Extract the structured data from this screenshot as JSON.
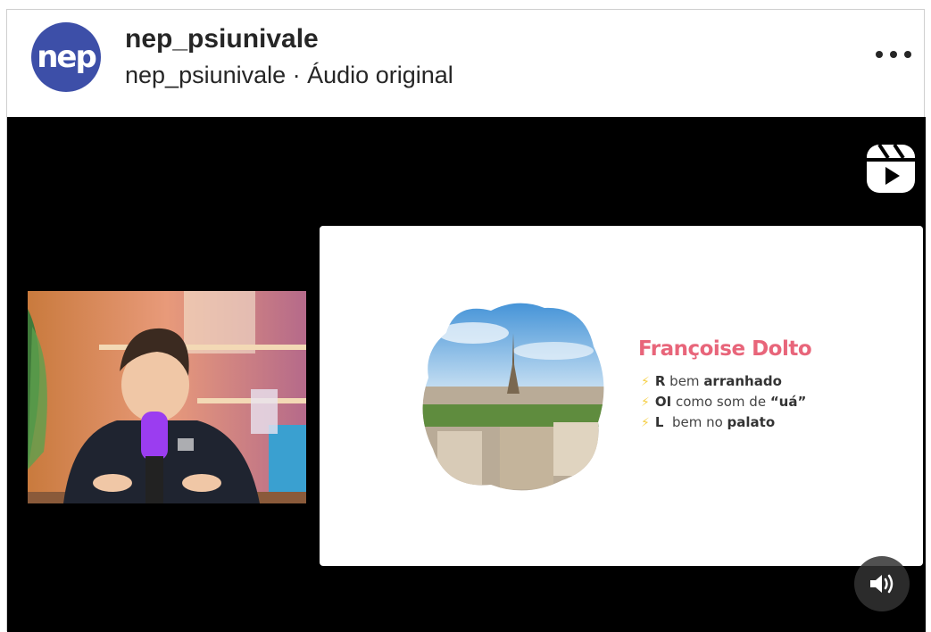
{
  "post": {
    "avatar_text": "nep",
    "username": "nep_psiunivale",
    "audio_label": "nep_psiunivale · Áudio original"
  },
  "icons": {
    "more": "more-options-icon",
    "reels": "reels-icon",
    "volume": "volume-icon",
    "bolt": "lightning-bolt-icon"
  },
  "colors": {
    "avatar_bg": "#3d4fa8",
    "slide_title": "#e8657a",
    "bolt": "#f5cf47",
    "microphone_glow": "#9b3df0"
  },
  "slide": {
    "title": "Françoise Dolto",
    "bullets": [
      {
        "pre": "R",
        "mid": " bem ",
        "bold": "arranhado",
        "post": ""
      },
      {
        "pre": "OI",
        "mid": " como som de ",
        "bold": "“uá”",
        "post": ""
      },
      {
        "pre": "L",
        "mid": "  bem no ",
        "bold": "palato",
        "post": ""
      }
    ]
  }
}
